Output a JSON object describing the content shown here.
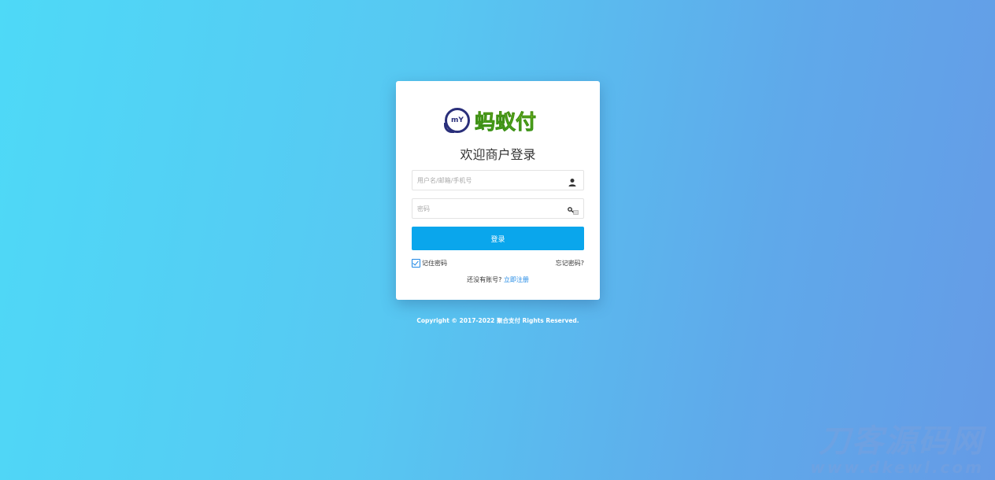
{
  "logo": {
    "circle_text": "mY",
    "brand_text": "蚂蚁付"
  },
  "login": {
    "title": "欢迎商户登录",
    "username_placeholder": "用户名/邮箱/手机号",
    "password_placeholder": "密码",
    "submit_label": "登录",
    "remember_label": "记住密码",
    "remember_checked": true,
    "forgot_label": "忘记密码?",
    "register_prompt": "还没有账号?",
    "register_link": "立即注册"
  },
  "footer": {
    "copyright": "Copyright © 2017-2022 聚合支付 Rights Reserved."
  },
  "watermark": {
    "cn": "刀客源码网",
    "url": "www.dkewl.com"
  },
  "colors": {
    "primary_button": "#0aa6ec",
    "link": "#1e88e5",
    "background_start": "#4ed9f7",
    "background_end": "#659be6"
  },
  "icons": {
    "username": "user-icon",
    "password": "key-icon"
  }
}
